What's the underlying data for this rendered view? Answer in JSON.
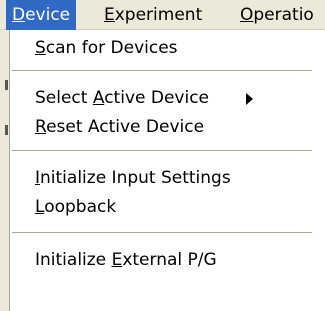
{
  "menubar": {
    "items": [
      {
        "mnemonic": "D",
        "rest": "evice"
      },
      {
        "mnemonic": "E",
        "rest": "xperiment"
      },
      {
        "mnemonic": "O",
        "rest": "peratio"
      }
    ]
  },
  "device_menu": {
    "scan": {
      "mnemonic": "S",
      "rest": "can for Devices"
    },
    "select_active": {
      "pre": "Select ",
      "mnemonic": "A",
      "rest": "ctive Device",
      "submenu_icon": "submenu-arrow-icon"
    },
    "reset_active": {
      "mnemonic": "R",
      "rest": "eset Active Device"
    },
    "init_input": {
      "mnemonic": "I",
      "rest": "nitialize Input Settings"
    },
    "loopback": {
      "mnemonic": "L",
      "rest": "oopback"
    },
    "init_external": {
      "pre": "Initialize ",
      "mnemonic": "E",
      "rest": "xternal P/G"
    }
  },
  "colors": {
    "menubar_bg": "#ece9d8",
    "highlight": "#316ac5",
    "separator": "#aca899"
  }
}
